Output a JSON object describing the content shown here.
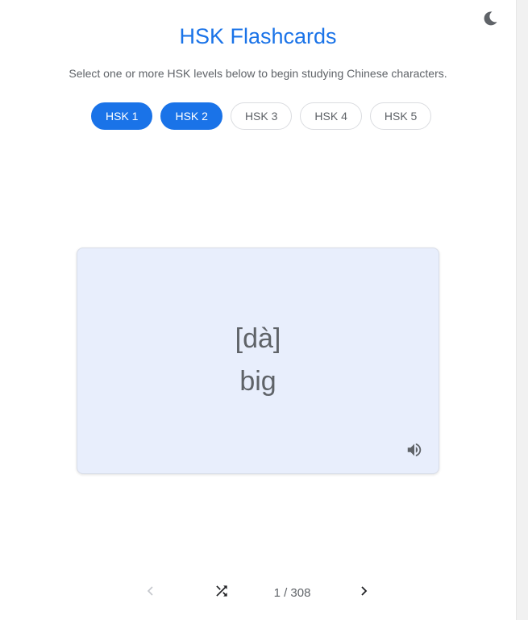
{
  "header": {
    "title": "HSK Flashcards",
    "subtitle": "Select one or more HSK levels below to begin studying Chinese characters.",
    "theme_toggle_icon": "moon-icon"
  },
  "levels": [
    {
      "label": "HSK 1",
      "selected": true
    },
    {
      "label": "HSK 2",
      "selected": true
    },
    {
      "label": "HSK 3",
      "selected": false
    },
    {
      "label": "HSK 4",
      "selected": false
    },
    {
      "label": "HSK 5",
      "selected": false
    }
  ],
  "card": {
    "pinyin": "[dà]",
    "meaning": "big",
    "audio_icon": "speaker-icon"
  },
  "navigation": {
    "prev_icon": "chevron-left-icon",
    "shuffle_icon": "shuffle-icon",
    "counter": "1 / 308",
    "next_icon": "chevron-right-icon"
  },
  "colors": {
    "accent": "#1a73e8",
    "card_background": "#e8eefc",
    "text_muted": "#5f6368"
  }
}
